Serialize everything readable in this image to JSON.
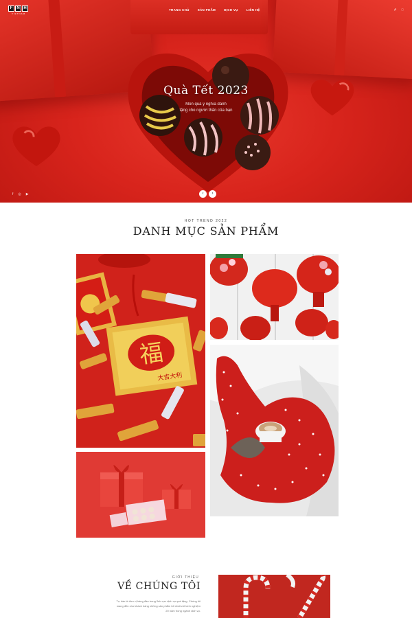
{
  "nav": {
    "logo_letters": [
      "F",
      "N",
      "H"
    ],
    "logo_tag": "VIETNAM",
    "menu": [
      "TRANG CHỦ",
      "SẢN PHẨM",
      "DỊCH VỤ",
      "LIÊN HỆ"
    ],
    "icons": [
      "search-icon",
      "cart-icon"
    ]
  },
  "hero": {
    "title": "Quà Tết 2023",
    "subtitle_line1": "Món quà ý nghĩa dành",
    "subtitle_line2": "tặng cho người thân của bạn",
    "socials": [
      "facebook-icon",
      "instagram-icon",
      "youtube-icon"
    ],
    "arrows": {
      "prev": "‹",
      "next": "›"
    }
  },
  "categories": {
    "eyebrow": "HOT TREND 2022",
    "title": "DANH MỤC SẢN PHẨM",
    "envelope_char": "福",
    "envelope_text": "大吉大利"
  },
  "about": {
    "eyebrow": "GIỚI THIỆU",
    "title": "VỀ CHÚNG TÔI",
    "body_line1": "Tự hào là đơn vị hàng đầu trong lĩnh vực dịch vụ quà tặng. Chúng tôi",
    "body_line2": "mang đến cho khách hàng những sản phẩm tốt nhất với kinh nghiệm",
    "body_line3": "20 năm trong ngành dịch vụ."
  },
  "colors": {
    "hero_red": "#d8241c",
    "accent_red": "#c81c14",
    "text_dark": "#1d1d1d"
  }
}
